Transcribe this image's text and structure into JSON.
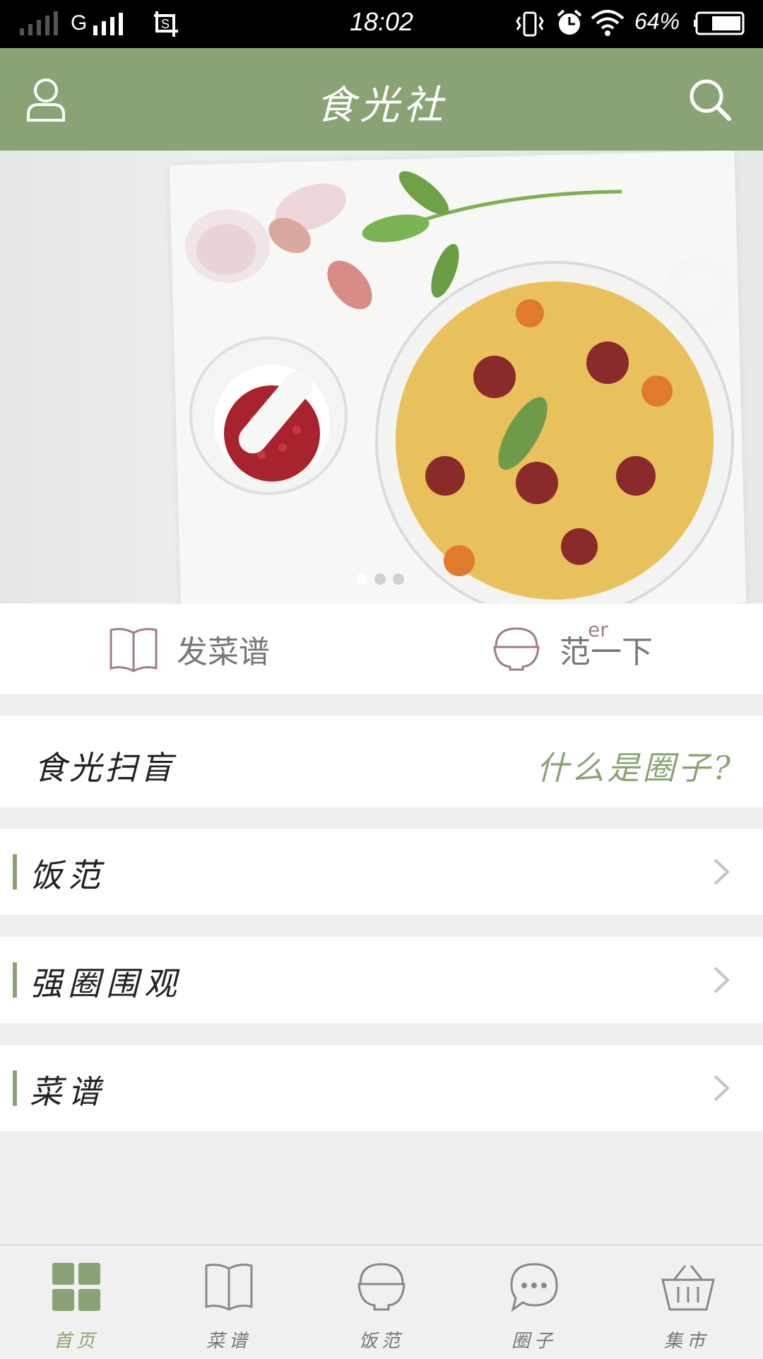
{
  "status_bar": {
    "carrier_label": "G",
    "time": "18:02",
    "battery": "64%"
  },
  "header": {
    "title": "食光社",
    "profile_icon": "person-icon",
    "search_icon": "search-icon"
  },
  "banner": {
    "image": "pasta-dish-photo",
    "page_count": 3,
    "active_index": 0
  },
  "actions": {
    "post_recipe": "发菜谱",
    "eat_label": "范一下",
    "eat_sup": "er"
  },
  "intro": {
    "left": "食光扫盲",
    "right": "什么是圈子?"
  },
  "rows": [
    {
      "label": "饭范"
    },
    {
      "label": "强圈围观"
    },
    {
      "label": "菜谱"
    }
  ],
  "colors": {
    "accent": "#8ba374",
    "header_bg": "#8ba374",
    "icon_mauve": "#a07c8c"
  },
  "bottom_nav": [
    {
      "label": "首页",
      "icon": "grid-icon",
      "active": true
    },
    {
      "label": "菜谱",
      "icon": "book-icon",
      "active": false
    },
    {
      "label": "饭范",
      "icon": "bowl-icon",
      "active": false
    },
    {
      "label": "圈子",
      "icon": "chat-bubble-icon",
      "active": false
    },
    {
      "label": "集市",
      "icon": "basket-icon",
      "active": false
    }
  ]
}
